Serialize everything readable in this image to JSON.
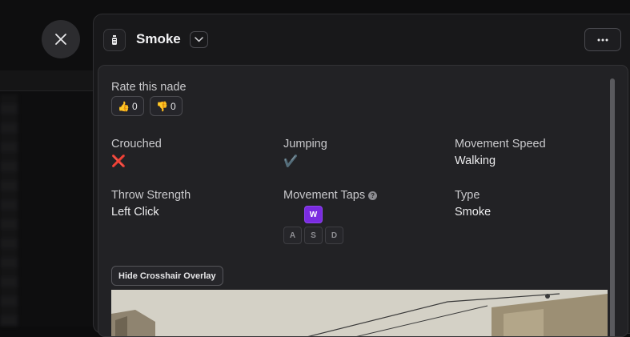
{
  "modal": {
    "title": "Smoke",
    "header_icon": "grenade-icon"
  },
  "rating": {
    "label": "Rate this nade",
    "thumbs_up_count": "0",
    "thumbs_down_count": "0",
    "thumbs_up_emoji": "👍",
    "thumbs_down_emoji": "👎"
  },
  "properties": {
    "crouched": {
      "label": "Crouched",
      "value": "❌"
    },
    "jumping": {
      "label": "Jumping",
      "value": "✔️"
    },
    "movement_speed": {
      "label": "Movement Speed",
      "value": "Walking"
    },
    "throw_strength": {
      "label": "Throw Strength",
      "value": "Left Click"
    },
    "movement_taps": {
      "label": "Movement Taps",
      "keys": [
        {
          "key": "W",
          "active": true
        },
        {
          "key": "A",
          "active": false
        },
        {
          "key": "S",
          "active": false
        },
        {
          "key": "D",
          "active": false
        }
      ]
    },
    "type": {
      "label": "Type",
      "value": "Smoke"
    }
  },
  "actions": {
    "hide_crosshair_overlay": "Hide Crosshair Overlay"
  },
  "colors": {
    "accent": "#7a2be0",
    "panel": "#18181a",
    "card": "#222225"
  }
}
